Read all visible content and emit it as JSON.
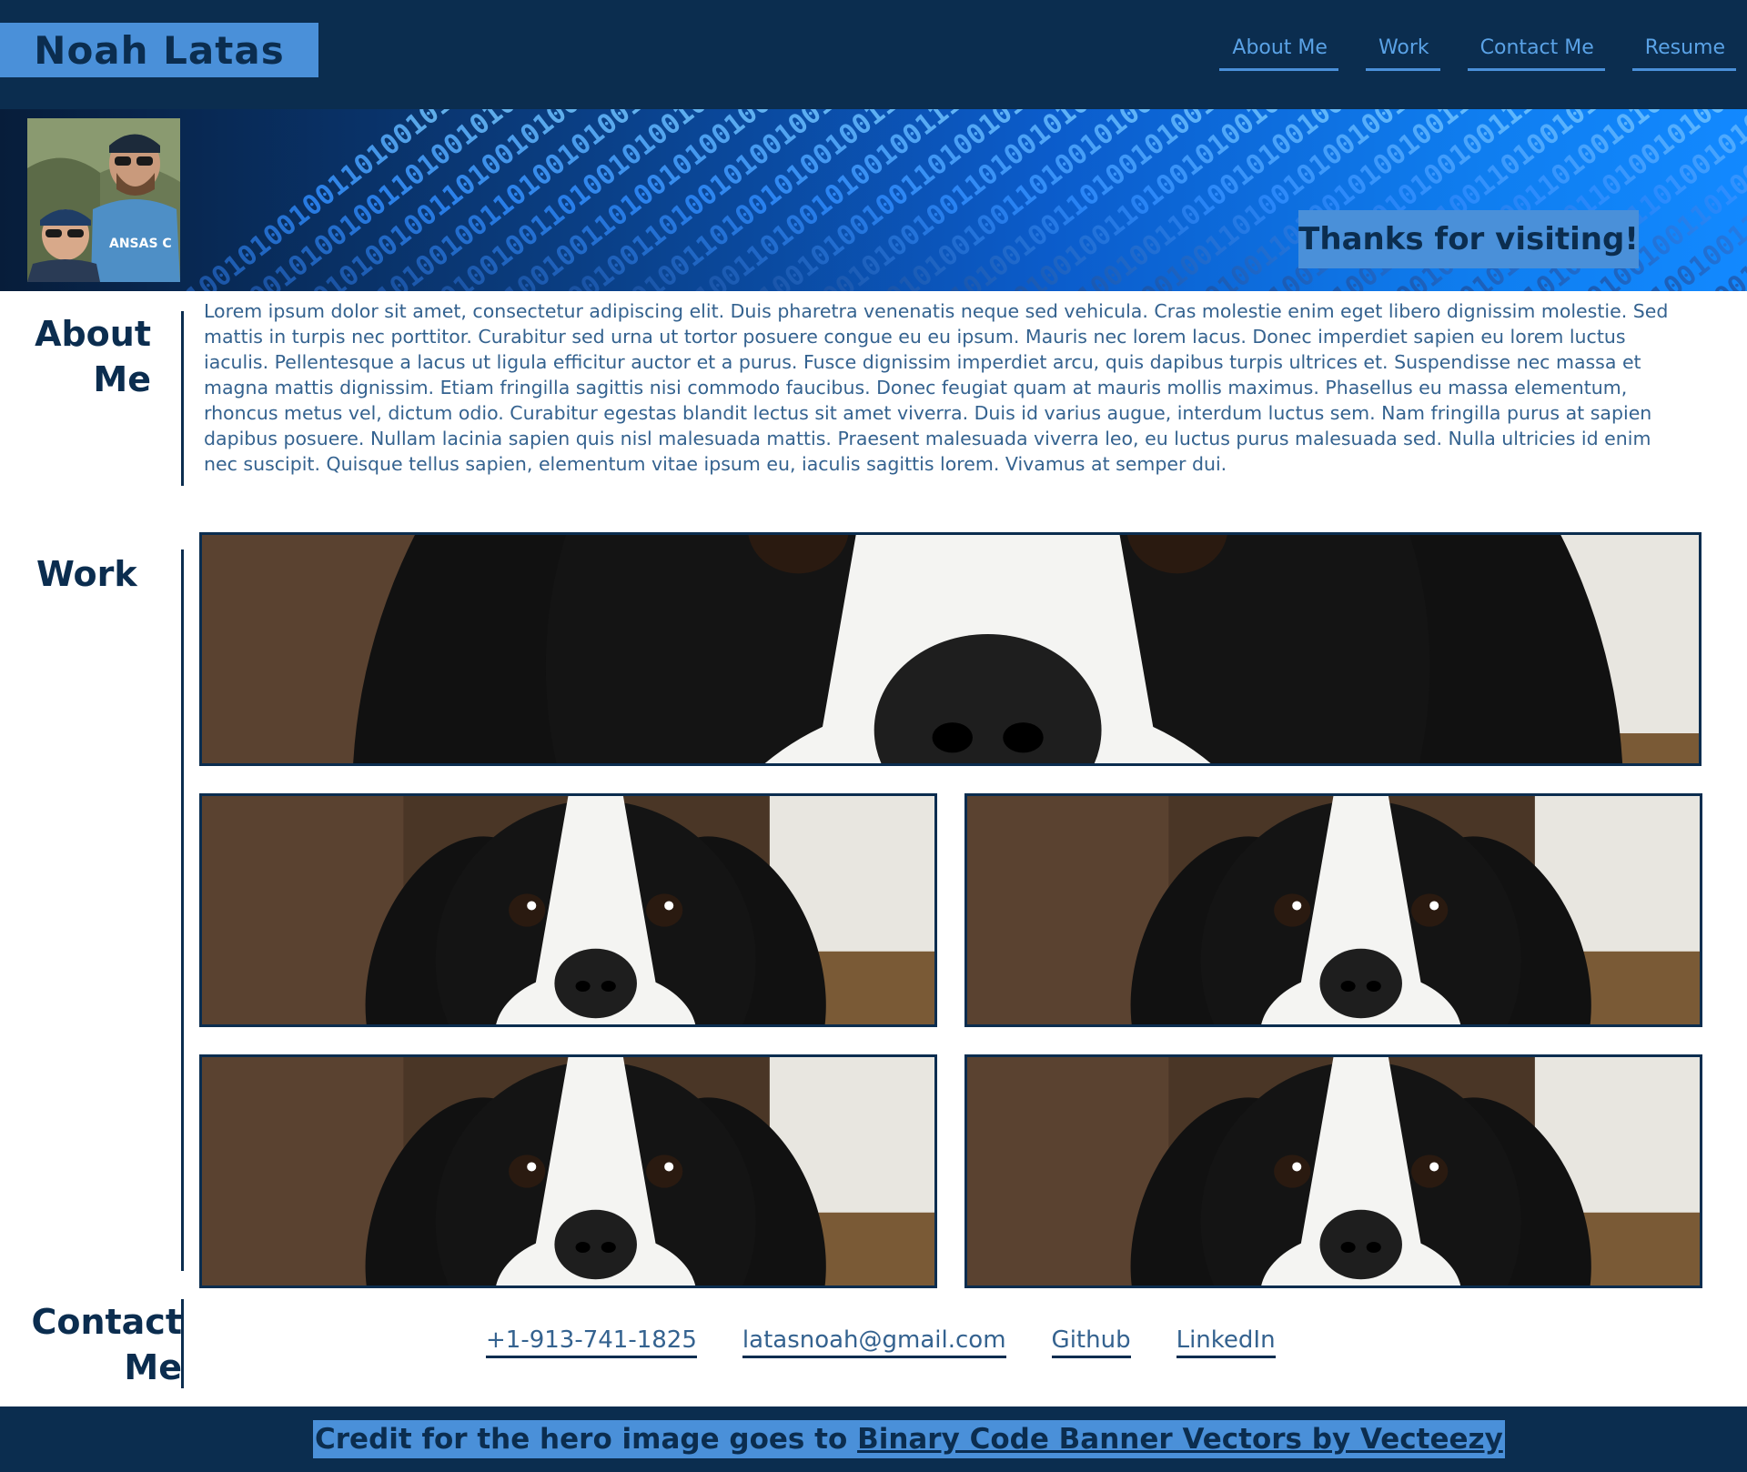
{
  "header": {
    "brand": "Noah Latas",
    "nav": [
      "About Me",
      "Work",
      "Contact Me",
      "Resume"
    ]
  },
  "hero": {
    "tagline": "Thanks for visiting!",
    "avatar_icon": "profile-photo"
  },
  "about": {
    "title_line1": "About",
    "title_line2": "Me",
    "text": "Lorem ipsum dolor sit amet, consectetur adipiscing elit. Duis pharetra venenatis neque sed vehicula. Cras molestie enim eget libero dignissim molestie. Sed mattis in turpis nec porttitor. Curabitur sed urna ut tortor posuere congue eu eu ipsum. Mauris nec lorem lacus. Donec imperdiet sapien eu lorem luctus iaculis. Pellentesque a lacus ut ligula efficitur auctor et a purus. Fusce dignissim imperdiet arcu, quis dapibus turpis ultrices et. Suspendisse nec massa et magna mattis dignissim. Etiam fringilla sagittis nisi commodo faucibus. Donec feugiat quam at mauris mollis maximus. Phasellus eu massa elementum, rhoncus metus vel, dictum odio. Curabitur egestas blandit lectus sit amet viverra. Duis id varius augue, interdum luctus sem. Nam fringilla purus at sapien dapibus posuere. Nullam lacinia sapien quis nisl malesuada mattis. Praesent malesuada viverra leo, eu luctus purus malesuada sed. Nulla ultricies id enim nec suscipit. Quisque tellus sapien, elementum vitae ipsum eu, iaculis sagittis lorem. Vivamus at semper dui."
  },
  "work": {
    "title": "Work",
    "image_icon": "dog-photo"
  },
  "contact": {
    "title_line1": "Contact",
    "title_line2": "Me",
    "phone": "+1-913-741-1825",
    "email": "latasnoah@gmail.com",
    "github": "Github",
    "linkedin": "LinkedIn"
  },
  "footer": {
    "credit_prefix": "Credit for the hero image goes to ",
    "credit_link": "Binary Code Banner Vectors by Vecteezy"
  },
  "colors": {
    "navy": "#0b2d4f",
    "accent": "#4a90d9",
    "text": "#34628f"
  }
}
